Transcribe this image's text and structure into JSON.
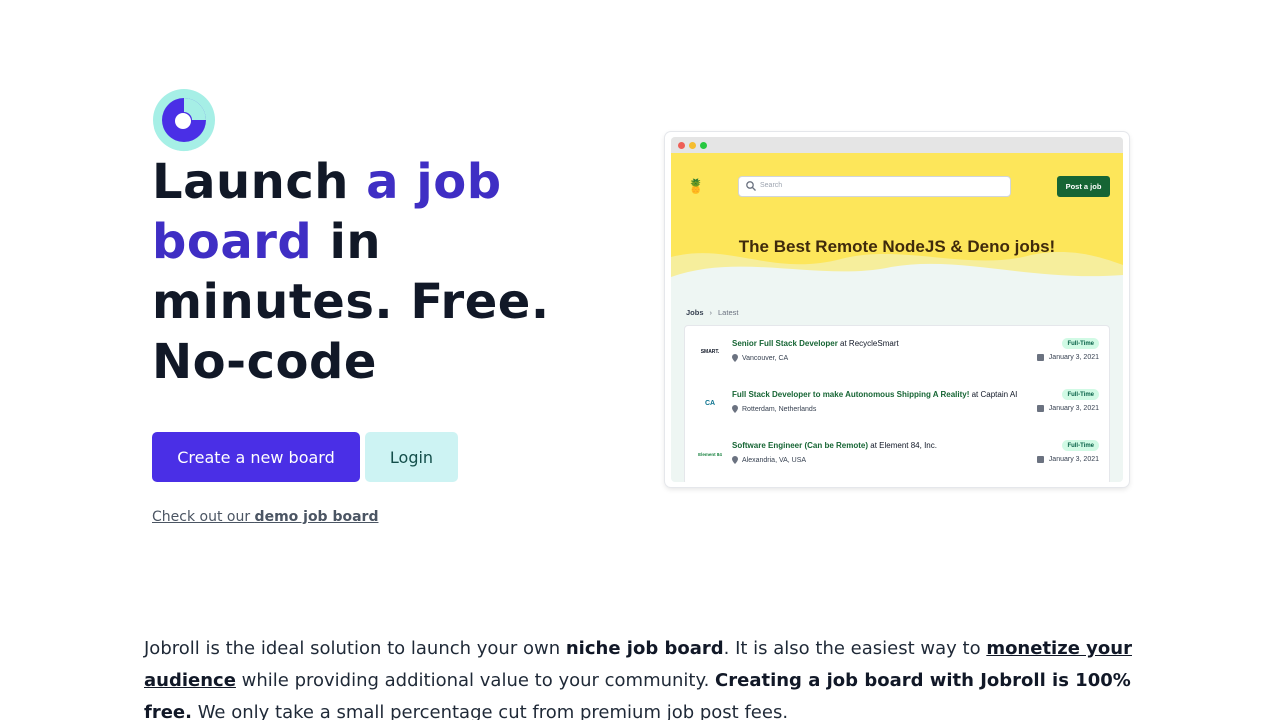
{
  "hero": {
    "headline_1": "Launch ",
    "headline_accent": "a job board",
    "headline_2": " in minutes. Free. No-code",
    "primary_button": "Create a new board",
    "secondary_button": "Login",
    "demo_prefix": "Check out our ",
    "demo_link": "demo job board"
  },
  "preview": {
    "brand_icon": "pineapple-icon",
    "search_placeholder": "Search",
    "post_button": "Post a job",
    "title": "The Best Remote NodeJS & Deno jobs!",
    "breadcrumb": [
      "Jobs",
      "Latest"
    ],
    "jobs": [
      {
        "logo": "SMART.",
        "title": "Senior Full Stack Developer",
        "company": " at RecycleSmart",
        "location": "Vancouver, CA",
        "badge": "Full-Time",
        "date": "January 3, 2021"
      },
      {
        "logo": "CA",
        "title": "Full Stack Developer to make Autonomous Shipping A Reality!",
        "company": " at Captain AI",
        "location": "Rotterdam, Netherlands",
        "badge": "Full-Time",
        "date": "January 3, 2021"
      },
      {
        "logo": "Element 84",
        "title": "Software Engineer (Can be Remote)",
        "company": " at Element 84, Inc.",
        "location": "Alexandria, VA, USA",
        "badge": "Full-Time",
        "date": "January 3, 2021"
      }
    ]
  },
  "about": {
    "p1": "Jobroll is the ideal solution to launch your own ",
    "b1": "niche job board",
    "p2": ". It is also the easiest way to ",
    "link": "monetize your audience",
    "p3": " while providing additional value to your community. ",
    "b2": "Creating a job board with Jobroll is 100% free.",
    "p4": " We only take a small percentage cut from premium job post fees."
  },
  "colors": {
    "accent": "#3f2ec4",
    "primary": "#4a2fe6",
    "secondary_bg": "#cdf3f3",
    "preview_yellow": "#fde65a",
    "preview_green": "#166534"
  }
}
